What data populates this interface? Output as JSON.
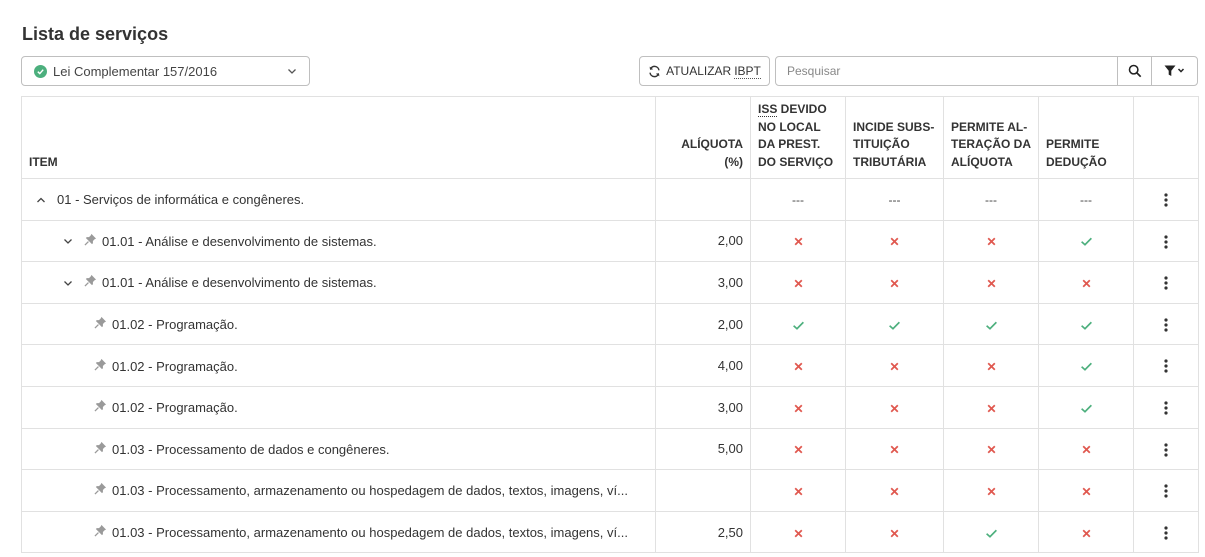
{
  "page": {
    "title": "Lista de serviços"
  },
  "law_select": {
    "value": "Lei Complementar 157/2016",
    "status_color": "#4caf7d"
  },
  "toolbar": {
    "ibpt_prefix": "ATUALIZAR",
    "ibpt_abbr": "IBPT"
  },
  "search": {
    "placeholder": "Pesquisar"
  },
  "columns": {
    "item": "ITEM",
    "aliquota": "ALÍQUOTA (%)",
    "iss_abbr": "ISS",
    "iss_rest": " DEVIDO NO LOCAL DA PREST. DO SERVIÇO",
    "subst": "INCIDE SUBS-TITUIÇÃO TRIBUTÁRIA",
    "altera": "PERMITE AL-TERAÇÃO DA ALÍQUOTA",
    "deducao": "PERMITE DEDUÇÃO"
  },
  "colors": {
    "check": "#4caf7d",
    "cross": "#e0584f"
  },
  "rows": [
    {
      "level": 0,
      "toggle": "up",
      "pin": false,
      "label": "01 - Serviços de informática e congêneres.",
      "aliquota": "",
      "iss": "---",
      "subst": "---",
      "altera": "---",
      "deducao": "---"
    },
    {
      "level": 1,
      "toggle": "down",
      "pin": true,
      "label": "01.01 - Análise e desenvolvimento de sistemas.",
      "aliquota": "2,00",
      "iss": "x",
      "subst": "x",
      "altera": "x",
      "deducao": "v"
    },
    {
      "level": 1,
      "toggle": "down",
      "pin": true,
      "label": "01.01 - Análise e desenvolvimento de sistemas.",
      "aliquota": "3,00",
      "iss": "x",
      "subst": "x",
      "altera": "x",
      "deducao": "x"
    },
    {
      "level": 2,
      "toggle": "",
      "pin": true,
      "label": "01.02 - Programação.",
      "aliquota": "2,00",
      "iss": "v",
      "subst": "v",
      "altera": "v",
      "deducao": "v"
    },
    {
      "level": 2,
      "toggle": "",
      "pin": true,
      "label": "01.02 - Programação.",
      "aliquota": "4,00",
      "iss": "x",
      "subst": "x",
      "altera": "x",
      "deducao": "v"
    },
    {
      "level": 2,
      "toggle": "",
      "pin": true,
      "label": "01.02 - Programação.",
      "aliquota": "3,00",
      "iss": "x",
      "subst": "x",
      "altera": "x",
      "deducao": "v"
    },
    {
      "level": 2,
      "toggle": "",
      "pin": true,
      "label": "01.03 - Processamento de dados e congêneres.",
      "aliquota": "5,00",
      "iss": "x",
      "subst": "x",
      "altera": "x",
      "deducao": "x"
    },
    {
      "level": 2,
      "toggle": "",
      "pin": true,
      "label": "01.03 - Processamento, armazenamento ou hospedagem de dados, textos, imagens, ví...",
      "aliquota": "",
      "iss": "x",
      "subst": "x",
      "altera": "x",
      "deducao": "x"
    },
    {
      "level": 2,
      "toggle": "",
      "pin": true,
      "label": "01.03 - Processamento, armazenamento ou hospedagem de dados, textos, imagens, ví...",
      "aliquota": "2,50",
      "iss": "x",
      "subst": "x",
      "altera": "v",
      "deducao": "x"
    }
  ]
}
